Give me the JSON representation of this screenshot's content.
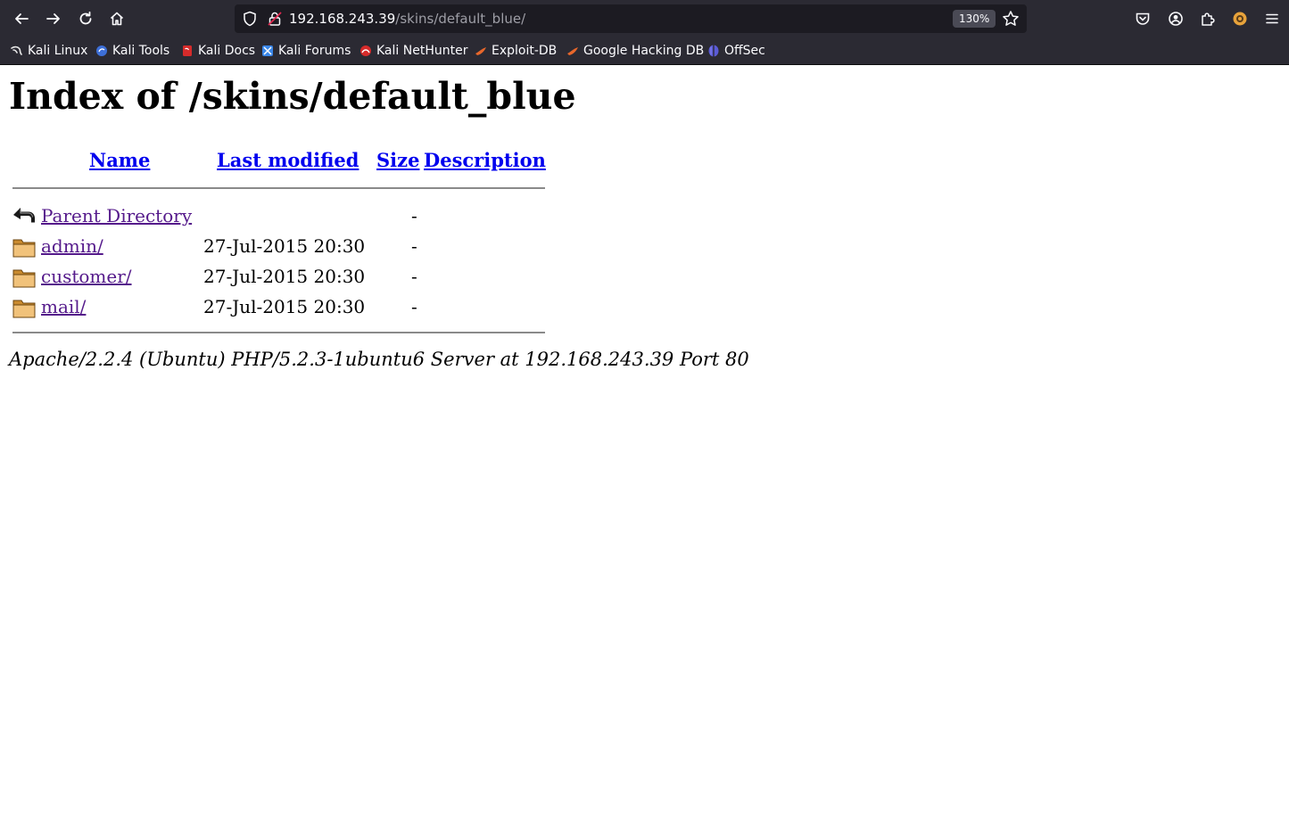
{
  "browser": {
    "url_host": "192.168.243.39",
    "url_path": "/skins/default_blue/",
    "zoom": "130%",
    "toolbar_icons": [
      "back-icon",
      "forward-icon",
      "reload-icon",
      "home-icon",
      "pocket-icon",
      "account-icon",
      "extensions-icon",
      "extension-badge-icon",
      "menu-icon"
    ]
  },
  "bookmarks": [
    {
      "label": "Kali Linux",
      "icon": "kali-linux-icon",
      "color": "#e8e8e8"
    },
    {
      "label": "Kali Tools",
      "icon": "kali-tools-icon",
      "color": "#3d6fd8"
    },
    {
      "label": "Kali Docs",
      "icon": "kali-docs-icon",
      "color": "#d62b2b"
    },
    {
      "label": "Kali Forums",
      "icon": "kali-forums-icon",
      "color": "#3a86e8"
    },
    {
      "label": "Kali NetHunter",
      "icon": "kali-nethunter-icon",
      "color": "#d62b2b"
    },
    {
      "label": "Exploit-DB",
      "icon": "exploit-db-icon",
      "color": "#e8672b"
    },
    {
      "label": "Google Hacking DB",
      "icon": "google-hacking-db-icon",
      "color": "#e8672b"
    },
    {
      "label": "OffSec",
      "icon": "offsec-icon",
      "color": "#5b5bd6"
    }
  ],
  "page": {
    "title": "Index of /skins/default_blue",
    "columns": {
      "name": "Name",
      "last_modified": "Last modified",
      "size": "Size",
      "description": "Description"
    },
    "rows": [
      {
        "name": "Parent Directory",
        "date": "",
        "size": "-",
        "icon": "parent-directory-icon"
      },
      {
        "name": "admin/",
        "date": "27-Jul-2015 20:30",
        "size": "-",
        "icon": "folder-icon"
      },
      {
        "name": "customer/",
        "date": "27-Jul-2015 20:30",
        "size": "-",
        "icon": "folder-icon"
      },
      {
        "name": "mail/",
        "date": "27-Jul-2015 20:30",
        "size": "-",
        "icon": "folder-icon"
      }
    ],
    "footer": "Apache/2.2.4 (Ubuntu) PHP/5.2.3-1ubuntu6 Server at 192.168.243.39 Port 80"
  }
}
